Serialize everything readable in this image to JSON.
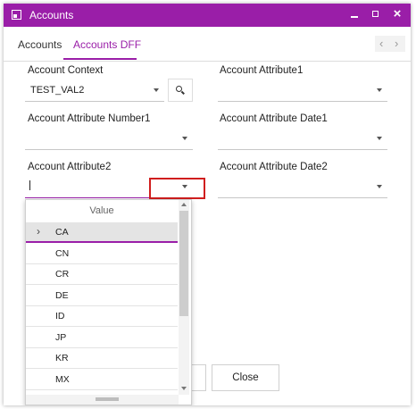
{
  "window": {
    "title": "Accounts"
  },
  "tabs": [
    {
      "label": "Accounts"
    },
    {
      "label": "Accounts DFF"
    }
  ],
  "fields": {
    "account_context": {
      "label": "Account Context",
      "value": "TEST_VAL2"
    },
    "account_attribute1": {
      "label": "Account Attribute1",
      "value": ""
    },
    "account_attribute_number1": {
      "label": "Account Attribute Number1",
      "value": ""
    },
    "account_attribute_date1": {
      "label": "Account Attribute Date1",
      "value": ""
    },
    "account_attribute2": {
      "label": "Account Attribute2",
      "value": ""
    },
    "account_attribute_date2": {
      "label": "Account Attribute Date2",
      "value": ""
    }
  },
  "dropdown": {
    "header": "Value",
    "selected_index": 0,
    "options": [
      "CA",
      "CN",
      "CR",
      "DE",
      "ID",
      "JP",
      "KR",
      "MX"
    ]
  },
  "footer": {
    "close_label": "Close"
  },
  "icons": {
    "app": "app-window-icon",
    "search": "search-icon",
    "minimize": "minimize-icon",
    "maximize": "maximize-icon",
    "close": "close-icon"
  },
  "colors": {
    "accent": "#9a1ea8",
    "highlight": "#d01e1e"
  }
}
